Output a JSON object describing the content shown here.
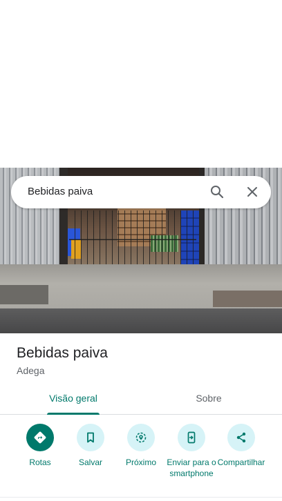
{
  "search": {
    "query": "Bebidas paiva",
    "search_icon": "search-icon",
    "clear_icon": "close-icon"
  },
  "place": {
    "name": "Bebidas paiva",
    "category": "Adega"
  },
  "tabs": [
    {
      "label": "Visão geral",
      "selected": true
    },
    {
      "label": "Sobre",
      "selected": false
    }
  ],
  "actions": [
    {
      "label": "Rotas",
      "icon": "directions-icon"
    },
    {
      "label": "Salvar",
      "icon": "bookmark-icon"
    },
    {
      "label": "Próximo",
      "icon": "nearby-icon"
    },
    {
      "label": "Enviar para o smartphone",
      "icon": "send-to-phone-icon"
    },
    {
      "label": "Compartilhar",
      "icon": "share-icon"
    }
  ],
  "colors": {
    "accent": "#00796b",
    "chip_bg": "#d6f3f7"
  }
}
